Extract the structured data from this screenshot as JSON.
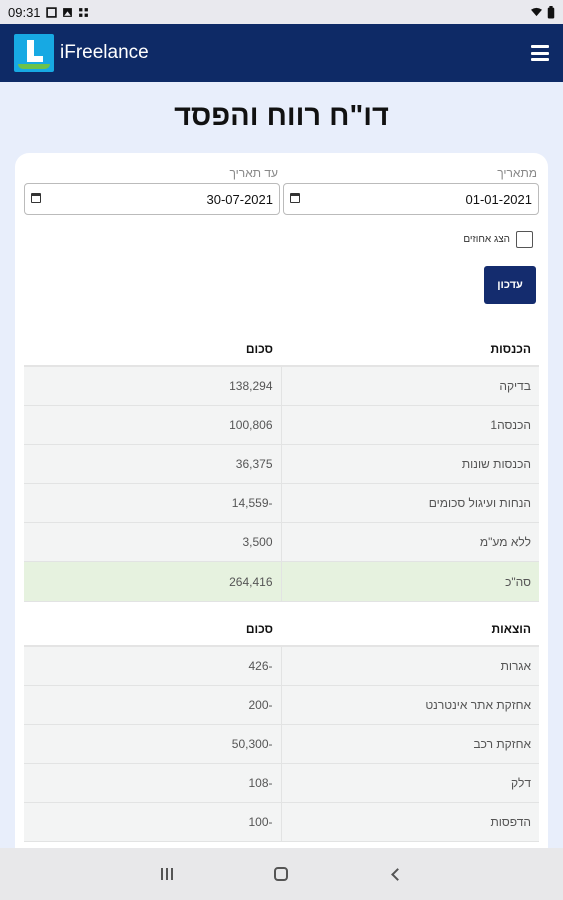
{
  "status_bar": {
    "time": "09:31"
  },
  "app": {
    "name": "iFreelance"
  },
  "page": {
    "title": "דו\"ח רווח והפסד"
  },
  "filters": {
    "from_label": "מתאריך",
    "from_value": "01-01-2021",
    "to_label": "עד תאריך",
    "to_value": "30-07-2021",
    "checkbox_label": "הצג אחוזים",
    "update_button": "עדכון"
  },
  "income": {
    "header_label": "הכנסות",
    "header_amount": "סכום",
    "rows": [
      {
        "label": "בדיקה",
        "amount": "138,294"
      },
      {
        "label": "הכנסה1",
        "amount": "100,806"
      },
      {
        "label": "הכנסות שונות",
        "amount": "36,375"
      },
      {
        "label": "הנחות ועיגול סכומים",
        "amount": "-14,559"
      },
      {
        "label": "ללא מע\"מ",
        "amount": "3,500"
      }
    ],
    "total": {
      "label": "סה\"כ",
      "amount": "264,416"
    }
  },
  "expenses": {
    "header_label": "הוצאות",
    "header_amount": "סכום",
    "rows": [
      {
        "label": "אגרות",
        "amount": "-426"
      },
      {
        "label": "אחזקת אתר אינטרנט",
        "amount": "-200"
      },
      {
        "label": "אחזקת רכב",
        "amount": "-50,300"
      },
      {
        "label": "דלק",
        "amount": "-108"
      },
      {
        "label": "הדפסות",
        "amount": "-100"
      }
    ]
  },
  "colors": {
    "app_bar": "#0e2a66",
    "page_background": "#e8eefb",
    "logo": "#17a9e3",
    "button": "#142c6e",
    "total_row": "#e6f2df"
  },
  "icons": {
    "logo": "app-logo-icon",
    "menu": "hamburger-menu-icon",
    "date": "calendar-icon"
  }
}
